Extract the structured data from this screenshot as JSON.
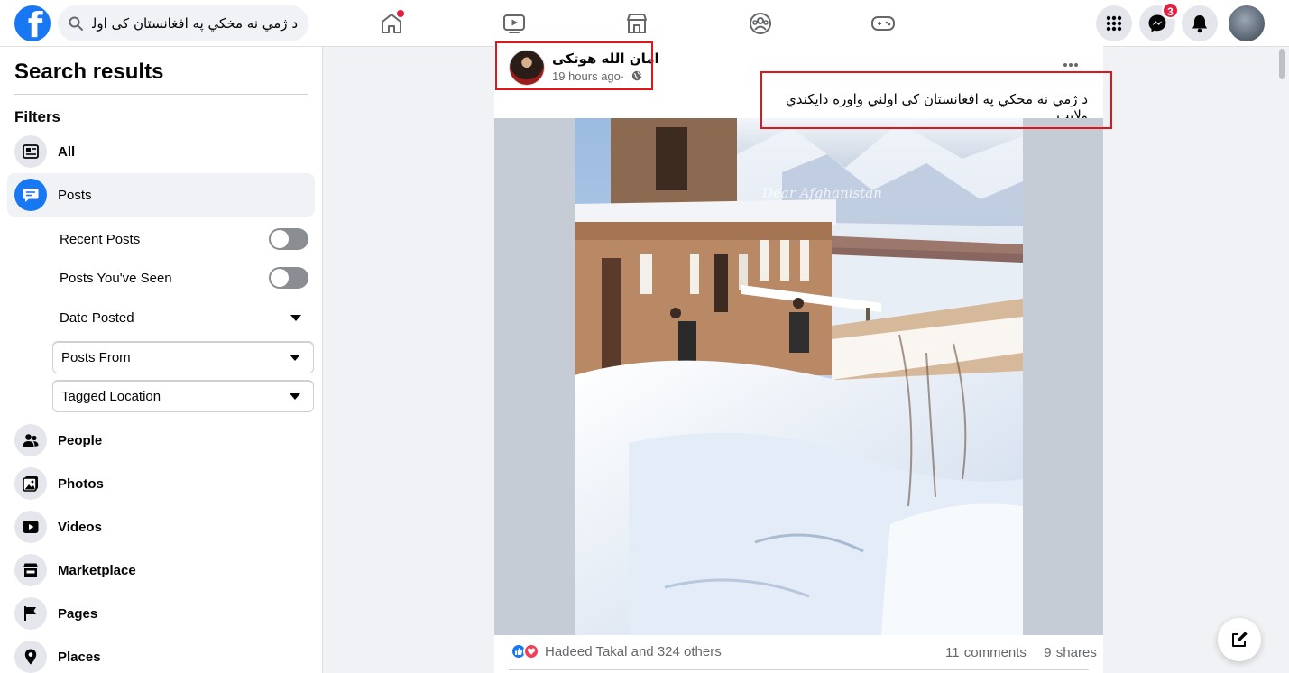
{
  "header": {
    "logo": "facebook-logo",
    "search_value": "د ژمي نه مخکي په افغانستان کی اولني وا",
    "nav": [
      "home",
      "watch",
      "marketplace",
      "groups",
      "gaming"
    ],
    "messenger_badge": "3"
  },
  "sidebar": {
    "title": "Search results",
    "filters_heading": "Filters",
    "items": [
      {
        "label": "All",
        "icon": "feed-icon"
      },
      {
        "label": "Posts",
        "icon": "posts-icon"
      },
      {
        "label": "People",
        "icon": "people-icon"
      },
      {
        "label": "Photos",
        "icon": "photos-icon"
      },
      {
        "label": "Videos",
        "icon": "videos-icon"
      },
      {
        "label": "Marketplace",
        "icon": "marketplace-icon"
      },
      {
        "label": "Pages",
        "icon": "flag-icon"
      },
      {
        "label": "Places",
        "icon": "location-pin-icon"
      }
    ],
    "post_filters": {
      "recent_posts": "Recent Posts",
      "posts_seen": "Posts You've Seen",
      "date_posted": "Date Posted",
      "posts_from": "Posts From",
      "tagged_location": "Tagged Location"
    }
  },
  "post": {
    "author": "امان الله هوتکی",
    "time": "19 hours ago",
    "time_sep": "·",
    "caption": "د ژمي نه مخکي په افغانستان کی اولني واوره دايکندي ولايت",
    "watermark": "Dear Afghanistan",
    "reactions_text": "Hadeed Takal and 324 others",
    "comments": "11 comments",
    "shares": "9 shares"
  },
  "colors": {
    "brand": "#1877f2",
    "highlight_box": "#e0161c",
    "badge": "#e41e3f"
  }
}
